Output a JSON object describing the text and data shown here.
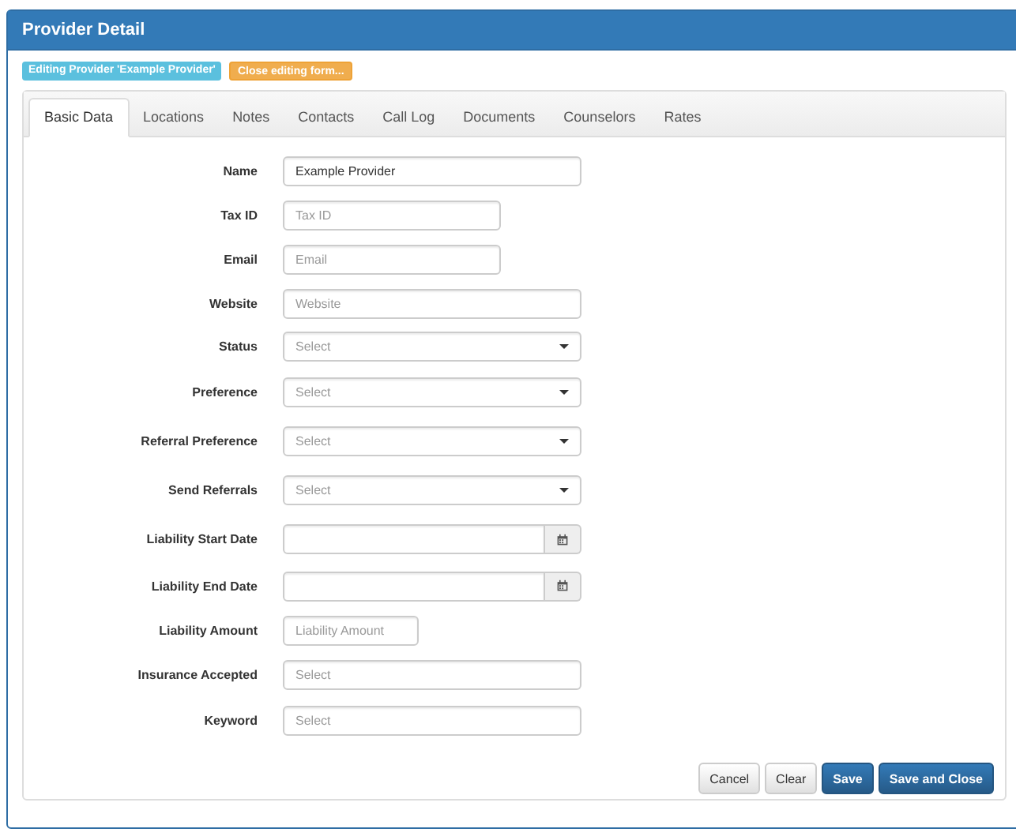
{
  "window": {
    "title": "Provider Detail"
  },
  "badges": [
    {
      "text": "Editing Provider 'Example Provider'",
      "kind": "info"
    },
    {
      "text": "Close editing form...",
      "kind": "warning"
    }
  ],
  "tabs": [
    {
      "label": "Basic Data",
      "selected": true
    },
    {
      "label": "Locations",
      "selected": false
    },
    {
      "label": "Notes",
      "selected": false
    },
    {
      "label": "Contacts",
      "selected": false
    },
    {
      "label": "Call Log",
      "selected": false
    },
    {
      "label": "Documents",
      "selected": false
    },
    {
      "label": "Counselors",
      "selected": false
    },
    {
      "label": "Rates",
      "selected": false
    }
  ],
  "fields": [
    {
      "label": "Name",
      "kind": "text",
      "value": "Example Provider"
    },
    {
      "label": "Tax ID",
      "kind": "text",
      "placeholder": "Tax ID"
    },
    {
      "label": "Email",
      "kind": "text",
      "placeholder": "Email"
    },
    {
      "label": "Website",
      "kind": "text",
      "placeholder": "Website"
    },
    {
      "label": "Status",
      "kind": "select",
      "placeholder": "Select"
    },
    {
      "label": "Preference",
      "kind": "select",
      "placeholder": "Select"
    },
    {
      "label": "Referral Preference",
      "kind": "select",
      "placeholder": "Select"
    },
    {
      "label": "Send Referrals",
      "kind": "select",
      "placeholder": "Select"
    },
    {
      "label": "Liability Start Date",
      "kind": "date"
    },
    {
      "label": "Liability End Date",
      "kind": "date"
    },
    {
      "label": "Liability Amount",
      "kind": "text",
      "placeholder": "Liability Amount"
    },
    {
      "label": "Insurance Accepted",
      "kind": "text",
      "placeholder": "Select"
    },
    {
      "label": "Keyword",
      "kind": "text",
      "placeholder": "Select"
    }
  ],
  "buttons": [
    {
      "label": "Cancel",
      "kind": "default"
    },
    {
      "label": "Clear",
      "kind": "default"
    },
    {
      "label": "Save",
      "kind": "primary"
    },
    {
      "label": "Save and Close",
      "kind": "primary"
    }
  ]
}
